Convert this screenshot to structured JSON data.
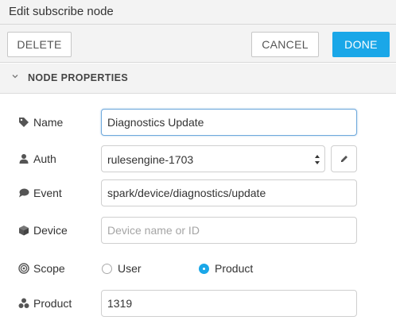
{
  "window": {
    "title": "Edit subscribe node"
  },
  "toolbar": {
    "delete_label": "DELETE",
    "cancel_label": "CANCEL",
    "done_label": "DONE"
  },
  "section": {
    "title": "NODE PROPERTIES",
    "icon": "chevron-down-icon"
  },
  "colors": {
    "primary": "#1aa7e8",
    "focus_border": "#6fa9dc",
    "panel_bg": "#f3f3f3"
  },
  "form": {
    "name": {
      "label": "Name",
      "icon": "tag-icon",
      "value": "Diagnostics Update"
    },
    "auth": {
      "label": "Auth",
      "icon": "user-icon",
      "selected": "rulesengine-1703",
      "edit_icon": "pencil-icon"
    },
    "event": {
      "label": "Event",
      "icon": "comment-icon",
      "value": "spark/device/diagnostics/update"
    },
    "device": {
      "label": "Device",
      "icon": "cube-icon",
      "value": "",
      "placeholder": "Device name or ID"
    },
    "scope": {
      "label": "Scope",
      "icon": "bullseye-icon",
      "options": [
        {
          "label": "User",
          "selected": false
        },
        {
          "label": "Product",
          "selected": true
        }
      ]
    },
    "product": {
      "label": "Product",
      "icon": "cubes-icon",
      "value": "1319"
    }
  }
}
